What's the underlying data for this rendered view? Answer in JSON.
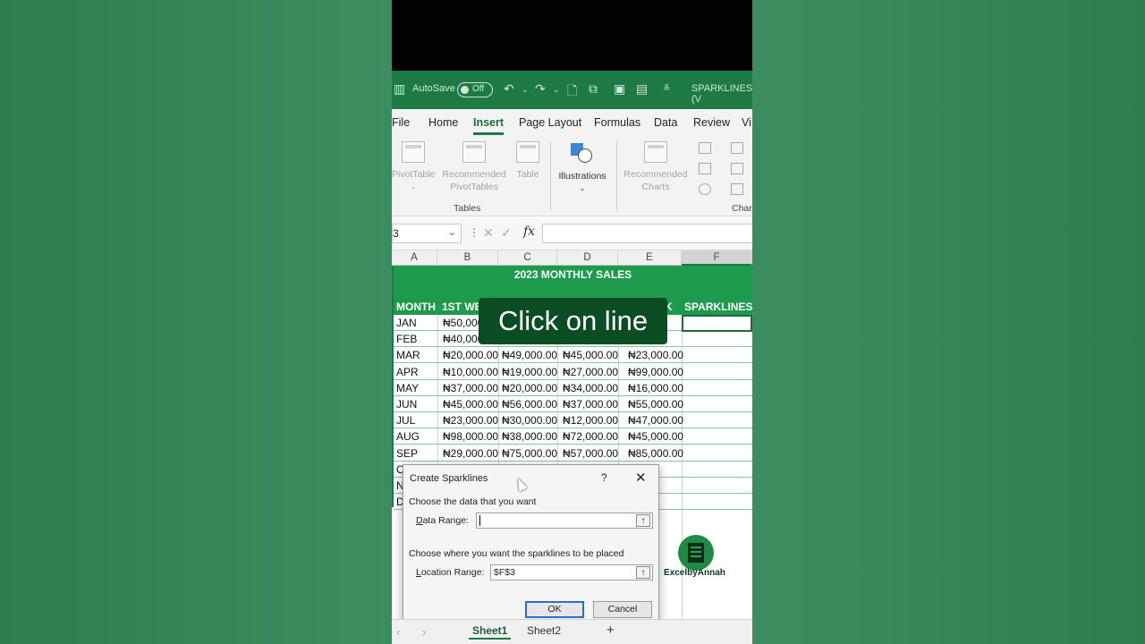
{
  "titlebar": {
    "autosave_label": "AutoSave",
    "autosave_state": "Off",
    "document_title": "SPARKLINES (V"
  },
  "menu": {
    "tabs": [
      "File",
      "Home",
      "Insert",
      "Page Layout",
      "Formulas",
      "Data",
      "Review",
      "Vi"
    ],
    "active": "Insert"
  },
  "ribbon": {
    "pivot_table": "PivotTable",
    "recommended_pivot_line1": "Recommended",
    "recommended_pivot_line2": "PivotTables",
    "table": "Table",
    "tables_group": "Tables",
    "illustrations": "Illustrations",
    "recommended_charts_line1": "Recommended",
    "recommended_charts_line2": "Charts",
    "charts_group": "Char"
  },
  "formula_bar": {
    "name_box": "3",
    "fx_label": "fx"
  },
  "sheet": {
    "columns": [
      "A",
      "B",
      "C",
      "D",
      "E",
      "F"
    ],
    "banner": "2023 MONTHLY SALES",
    "header_month": "MONTH",
    "header_week1": "1ST WE",
    "header_week4_tail": "K",
    "header_sparklines": "SPARKLINES",
    "rows": [
      {
        "month": "JAN",
        "b": "₦50,000",
        "c": "",
        "d": "",
        "e": ".00"
      },
      {
        "month": "FEB",
        "b": "₦40,000",
        "c": "",
        "d": "",
        "e": ".00"
      },
      {
        "month": "MAR",
        "b": "₦20,000.00",
        "c": "₦49,000.00",
        "d": "₦45,000.00",
        "e": "₦23,000.00"
      },
      {
        "month": "APR",
        "b": "₦10,000.00",
        "c": "₦19,000.00",
        "d": "₦27,000.00",
        "e": "₦99,000.00"
      },
      {
        "month": "MAY",
        "b": "₦37,000.00",
        "c": "₦20,000.00",
        "d": "₦34,000.00",
        "e": "₦16,000.00"
      },
      {
        "month": "JUN",
        "b": "₦45,000.00",
        "c": "₦56,000.00",
        "d": "₦37,000.00",
        "e": "₦55,000.00"
      },
      {
        "month": "JUL",
        "b": "₦23,000.00",
        "c": "₦30,000.00",
        "d": "₦12,000.00",
        "e": "₦47,000.00"
      },
      {
        "month": "AUG",
        "b": "₦98,000.00",
        "c": "₦38,000.00",
        "d": "₦72,000.00",
        "e": "₦45,000.00"
      },
      {
        "month": "SEP",
        "b": "₦29,000.00",
        "c": "₦75,000.00",
        "d": "₦57,000.00",
        "e": "₦85,000.00"
      },
      {
        "month": "O",
        "b": "",
        "c": "",
        "d": "",
        "e": ".00"
      },
      {
        "month": "N",
        "b": "",
        "c": "",
        "d": "",
        "e": ".00"
      },
      {
        "month": "D",
        "b": "",
        "c": "",
        "d": "",
        "e": ".00"
      }
    ]
  },
  "overlay_text": "Click on line",
  "logo_text": "ExcelbyAnnah",
  "dialog": {
    "title": "Create Sparklines",
    "help": "?",
    "close": "✕",
    "section1": "Choose the data that you want",
    "data_range_label_u": "D",
    "data_range_label_rest": "ata Range:",
    "data_range_value": "",
    "section2": "Choose where you want the sparklines to be placed",
    "location_label_u": "L",
    "location_label_rest": "ocation Range:",
    "location_value": "$F$3",
    "ok": "OK",
    "cancel": "Cancel"
  },
  "sheet_tabs": {
    "tabs": [
      "Sheet1",
      "Sheet2"
    ],
    "add": "+"
  },
  "colors": {
    "excel_green": "#1e7a45",
    "table_header": "#1e9a4c",
    "overlay_bg": "#0b4d23"
  }
}
